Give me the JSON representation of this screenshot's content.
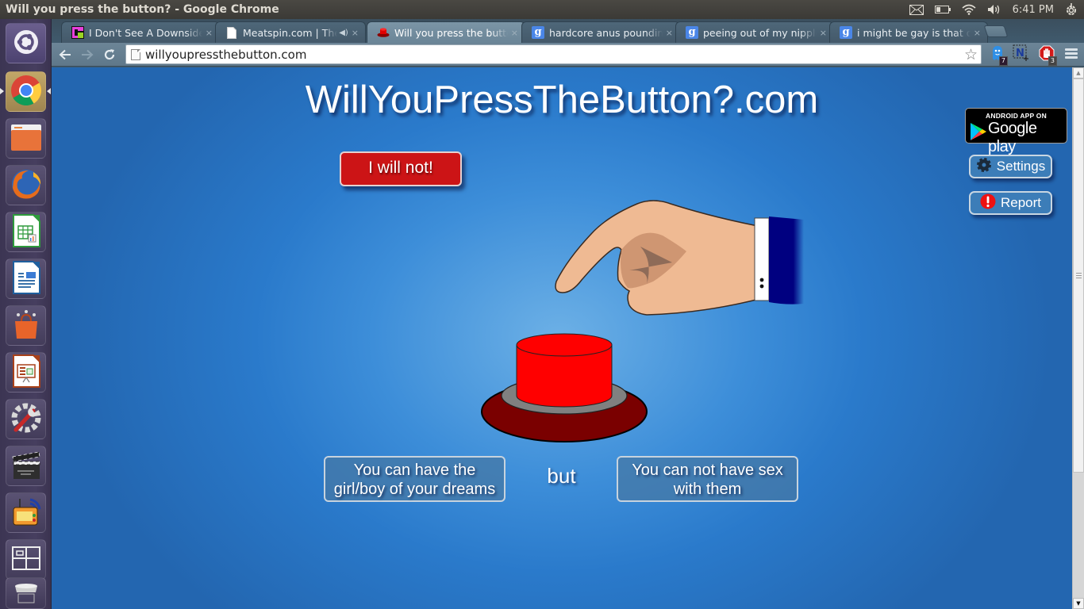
{
  "panel": {
    "window_title": "Will you press the button? - Google Chrome",
    "clock": "6:41 PM",
    "indicators": [
      "mail-icon",
      "battery-icon",
      "wifi-icon",
      "volume-icon",
      "power-gear-icon"
    ]
  },
  "launcher": {
    "items": [
      {
        "name": "ubuntu-dash",
        "icon": "ubuntu-logo-icon"
      },
      {
        "name": "google-chrome",
        "icon": "chrome-icon",
        "active": true
      },
      {
        "name": "files",
        "icon": "folder-icon"
      },
      {
        "name": "firefox",
        "icon": "firefox-icon"
      },
      {
        "name": "libreoffice-calc",
        "icon": "spreadsheet-icon"
      },
      {
        "name": "libreoffice-writer",
        "icon": "document-icon"
      },
      {
        "name": "ubuntu-software-center",
        "icon": "shopping-bag-icon"
      },
      {
        "name": "libreoffice-impress",
        "icon": "presentation-icon"
      },
      {
        "name": "system-settings",
        "icon": "wrench-gear-icon"
      },
      {
        "name": "video-editor",
        "icon": "clapperboard-icon"
      },
      {
        "name": "network-app",
        "icon": "radio-device-icon"
      },
      {
        "name": "workspace-switcher",
        "icon": "workspaces-icon"
      },
      {
        "name": "trash",
        "icon": "trash-icon"
      }
    ]
  },
  "browser": {
    "tabs": [
      {
        "title": "I Don't See A Downside",
        "favicon": "f-logo-icon"
      },
      {
        "title": "Meatspin.com | The Site",
        "favicon": "page-icon",
        "audio": true
      },
      {
        "title": "Will you press the button?",
        "favicon": "red-button-icon",
        "active": true
      },
      {
        "title": "hardcore anus pounding - Google Search",
        "favicon": "google-icon"
      },
      {
        "title": "peeing out of my nipples - Google Search",
        "favicon": "google-icon"
      },
      {
        "title": "i might be gay is that ok - Google Search",
        "favicon": "google-icon"
      }
    ],
    "url": "willyoupressthebutton.com",
    "extensions": [
      {
        "name": "ghostery",
        "badge": "7"
      },
      {
        "name": "evernote-clipper",
        "badge": ""
      },
      {
        "name": "adblock",
        "badge": "3"
      }
    ],
    "google_glyph": "g",
    "close_glyph": "×",
    "star_glyph": "☆"
  },
  "page": {
    "site_title": "WillYouPressTheButton?.com",
    "refuse_label": "I will not!",
    "play_badge": {
      "small": "ANDROID APP ON",
      "big": "Google play"
    },
    "settings_label": "Settings",
    "report_label": "Report",
    "benefit": [
      "You can have the",
      "girl/boy of your dreams"
    ],
    "but_label": "but",
    "drawback": [
      "You can not have sex",
      "with them"
    ],
    "colors": {
      "background": "#2a7acb",
      "refuse_button": "#cc1416",
      "button_top": "#ff0000",
      "button_base": "#7a0000",
      "button_ring": "#808080",
      "sleeve": "#000080"
    }
  }
}
